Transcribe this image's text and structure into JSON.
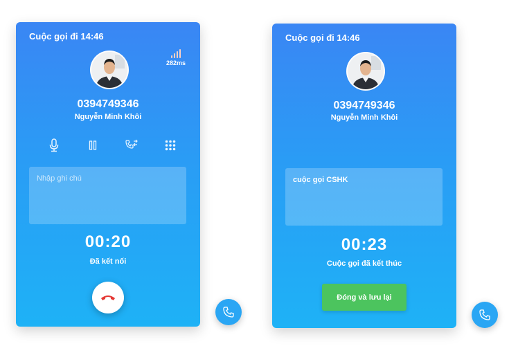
{
  "left_panel": {
    "title": "Cuộc gọi đi 14:46",
    "latency": "282ms",
    "phone": "0394749346",
    "name": "Nguyễn Minh Khôi",
    "note_placeholder": "Nhập ghi chú",
    "timer": "00:20",
    "status": "Đã kết nối"
  },
  "right_panel": {
    "title": "Cuộc gọi đi 14:46",
    "phone": "0394749346",
    "name": "Nguyễn Minh Khôi",
    "note_value": "cuộc gọi CSHK",
    "timer": "00:23",
    "status": "Cuộc gọi đã kết thúc",
    "save_label": "Đóng và lưu lại"
  },
  "icons": {
    "microphone": "microphone-icon",
    "pause": "pause-icon",
    "transfer": "call-transfer-icon",
    "keypad": "keypad-icon",
    "hangup": "hangup-icon",
    "phone_fab": "phone-icon",
    "signal": "signal-icon"
  },
  "colors": {
    "gradient_top": "#3a86f4",
    "gradient_bottom": "#1eb2f6",
    "hangup_icon": "#e53935",
    "save_button": "#4cc45e"
  }
}
